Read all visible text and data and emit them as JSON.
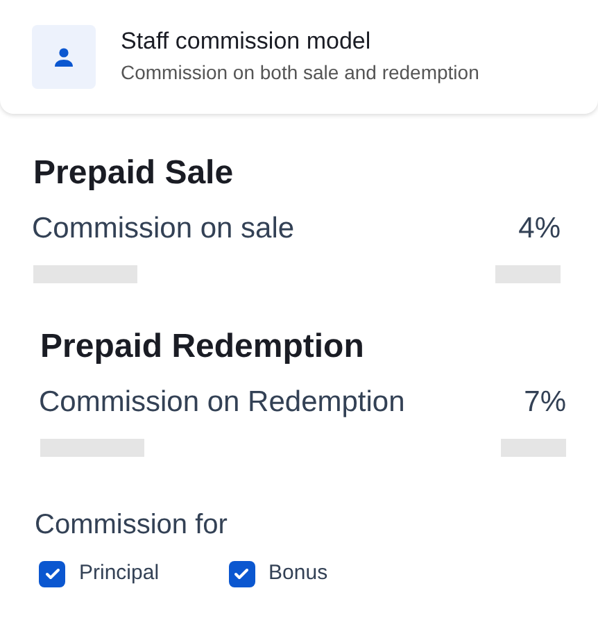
{
  "model_card": {
    "title": "Staff commission model",
    "subtitle": "Commission on both sale and redemption"
  },
  "sections": [
    {
      "heading": "Prepaid Sale",
      "label": "Commission on sale",
      "value": "4%"
    },
    {
      "heading": "Prepaid Redemption",
      "label": "Commission on Redemption",
      "value": "7%"
    }
  ],
  "commission_for": {
    "label": "Commission for",
    "options": [
      {
        "label": "Principal",
        "checked": true
      },
      {
        "label": "Bonus",
        "checked": true
      }
    ]
  }
}
